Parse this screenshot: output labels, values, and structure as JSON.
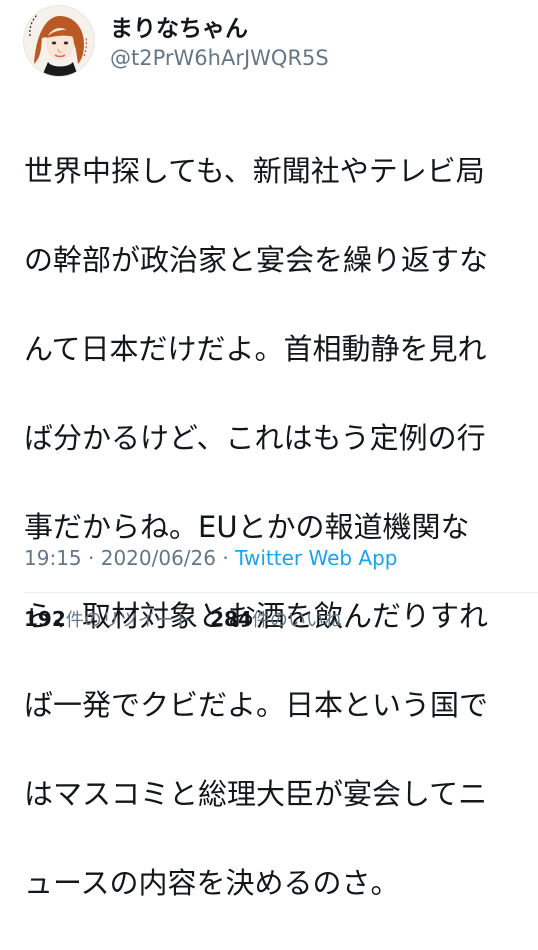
{
  "user": {
    "display_name": "まりなちゃん",
    "handle": "@t2PrW6hArJWQR5S"
  },
  "tweet": {
    "lines": [
      "世界中探しても、新聞社やテレビ局",
      "の幹部が政治家と宴会を繰り返すな",
      "んて日本だけだよ。首相動静を見れ",
      "ば分かるけど、これはもう定例の行",
      "事だからね。EUとかの報道機関な",
      "ら、取材対象とお酒を飲んだりすれ",
      "ば一発でクビだよ。日本という国で",
      "はマスコミと総理大臣が宴会してニ",
      "ュースの内容を決めるのさ。"
    ]
  },
  "meta": {
    "time": "19:15",
    "separator": " · ",
    "date": "2020/06/26",
    "source": "Twitter Web App"
  },
  "stats": {
    "retweets": {
      "count": "192",
      "label": "件のリツイート"
    },
    "likes": {
      "count": "284",
      "label": "件のいいね"
    }
  },
  "colors": {
    "text": "#14171a",
    "secondary": "#657786",
    "link": "#1da1f2",
    "divider": "#e6ecf0"
  },
  "icons": {
    "avatar": "illustrated-portrait-avatar"
  }
}
